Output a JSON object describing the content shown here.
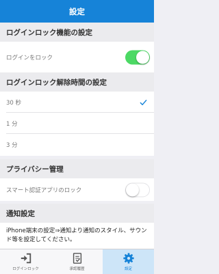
{
  "nav": {
    "title": "設定"
  },
  "sections": {
    "login_lock": {
      "header": "ログインロック機能の設定",
      "row_label": "ログインをロック",
      "toggle_on": true
    },
    "unlock_time": {
      "header": "ログインロック解除時間の設定",
      "options": [
        "30 秒",
        "1 分",
        "3 分"
      ],
      "selected": "30 秒"
    },
    "privacy": {
      "header": "プライバシー管理",
      "row_label": "スマート認証アプリのロック",
      "toggle_on": false
    },
    "notification": {
      "header": "通知設定",
      "text": "iPhone端末の設定⇒通知より通知のスタイル、サウンド等を設定してください。"
    }
  },
  "tabbar": {
    "tabs": [
      {
        "label": "ログインロック",
        "icon": "login-arrow-icon",
        "active": false
      },
      {
        "label": "承認履歴",
        "icon": "history-document-icon",
        "active": false
      },
      {
        "label": "設定",
        "icon": "gear-icon",
        "active": true
      }
    ]
  },
  "colors": {
    "accent": "#1683d8",
    "toggle_on": "#4cd964",
    "background": "#efeff4"
  }
}
